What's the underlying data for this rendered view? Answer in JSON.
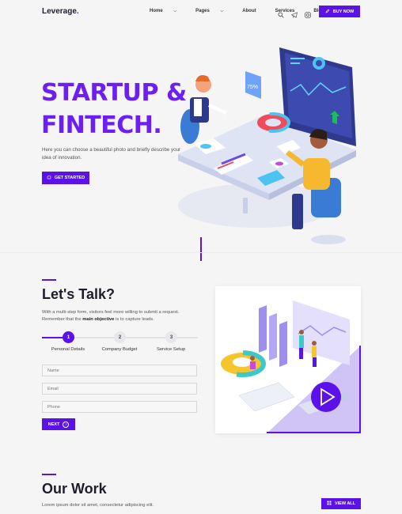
{
  "brand": {
    "name": "Leverage",
    "dot": "."
  },
  "nav": {
    "items": [
      {
        "label": "Home",
        "dropdown": true
      },
      {
        "label": "Pages",
        "dropdown": true
      },
      {
        "label": "About",
        "dropdown": false
      },
      {
        "label": "Services",
        "dropdown": false
      },
      {
        "label": "Blog",
        "dropdown": true
      }
    ],
    "icons": [
      "search-icon",
      "telegram-icon",
      "instagram-icon"
    ],
    "cta_label": "BUY NOW"
  },
  "hero": {
    "title_line1": "STARTUP &",
    "title_line2": "FINTECH.",
    "description": "Here you can choose a beautiful photo and briefly describe your idea of innovation.",
    "cta_label": "GET STARTED",
    "chart_percent": "75%"
  },
  "contact": {
    "title": "Let's Talk?",
    "desc_part1": "With a multi-step form, visitors feel more willing to submit a request. Remember that the ",
    "desc_bold": "main objective",
    "desc_part2": " is to capture leads.",
    "steps": [
      {
        "number": "1",
        "label": "Personal Details"
      },
      {
        "number": "2",
        "label": "Company Budget"
      },
      {
        "number": "3",
        "label": "Service Setup"
      }
    ],
    "active_step": 1,
    "fields": {
      "name_placeholder": "Name",
      "email_placeholder": "Email",
      "phone_placeholder": "Phone"
    },
    "next_label": "NEXT"
  },
  "work": {
    "title": "Our Work",
    "description": "Lorem ipsum dolor sit amet, consectetur adipiscing elit.",
    "cta_label": "VIEW ALL"
  },
  "colors": {
    "accent": "#5a12e8",
    "title": "#6b1ff2",
    "background": "#f5f5f6"
  }
}
